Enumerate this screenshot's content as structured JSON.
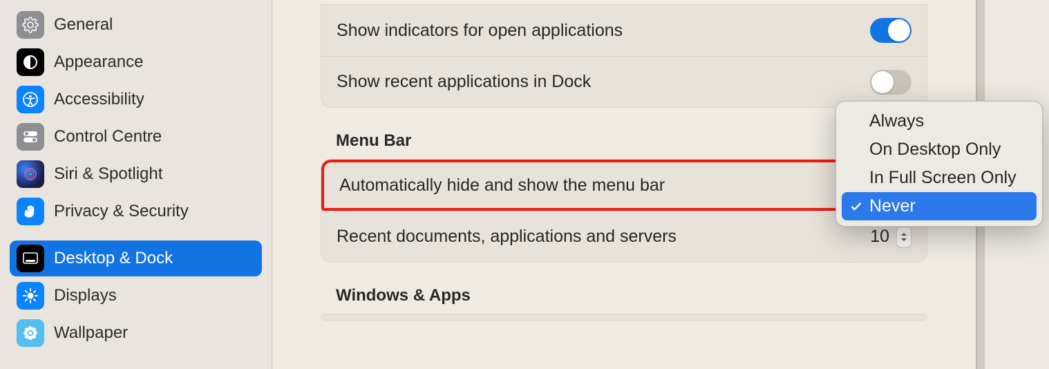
{
  "sidebar": {
    "items": [
      {
        "label": "General",
        "icon": "gear-icon",
        "selected": false
      },
      {
        "label": "Appearance",
        "icon": "appearance-icon",
        "selected": false
      },
      {
        "label": "Accessibility",
        "icon": "accessibility-icon",
        "selected": false
      },
      {
        "label": "Control Centre",
        "icon": "toggles-icon",
        "selected": false
      },
      {
        "label": "Siri & Spotlight",
        "icon": "siri-icon",
        "selected": false
      },
      {
        "label": "Privacy & Security",
        "icon": "hand-icon",
        "selected": false
      },
      {
        "label": "Desktop & Dock",
        "icon": "dock-icon",
        "selected": true
      },
      {
        "label": "Displays",
        "icon": "sun-icon",
        "selected": false
      },
      {
        "label": "Wallpaper",
        "icon": "flower-icon",
        "selected": false
      }
    ]
  },
  "main": {
    "rows": {
      "show_indicators": {
        "label": "Show indicators for open applications",
        "value": true
      },
      "show_recent": {
        "label": "Show recent applications in Dock",
        "value": false
      },
      "autohide_menubar": {
        "label": "Automatically hide and show the menu bar"
      },
      "recent_docs": {
        "label": "Recent documents, applications and servers",
        "value": "10"
      }
    },
    "sections": {
      "menu_bar": "Menu Bar",
      "windows_apps": "Windows & Apps"
    }
  },
  "popup": {
    "options": [
      {
        "label": "Always",
        "selected": false
      },
      {
        "label": "On Desktop Only",
        "selected": false
      },
      {
        "label": "In Full Screen Only",
        "selected": false
      },
      {
        "label": "Never",
        "selected": true
      }
    ]
  }
}
